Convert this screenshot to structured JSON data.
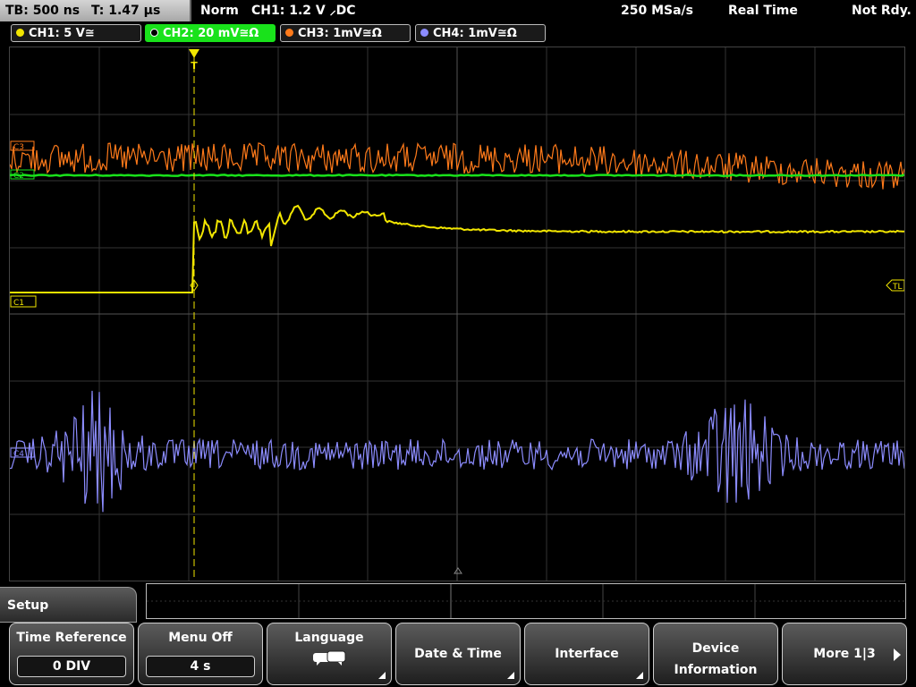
{
  "topbar": {
    "timebase": "TB: 500 ns",
    "trigger_time": "T: 1.47 µs",
    "mode": "Norm",
    "trigger_info": "CH1: 1.2 V ⸝DC",
    "sample_rate": "250 MSa/s",
    "acq_mode": "Real Time",
    "status": "Not Rdy."
  },
  "channels": [
    {
      "label": "CH1: 5 V≅",
      "color": "#f2e600",
      "active": false
    },
    {
      "label": "CH2: 20 mV≅Ω",
      "color": "#19e21b",
      "active": true
    },
    {
      "label": "CH3: 1mV≅Ω",
      "color": "#ff7a1a",
      "active": false
    },
    {
      "label": "CH4: 1mV≅Ω",
      "color": "#8c8cff",
      "active": false
    }
  ],
  "markers": {
    "c1": "C1",
    "c2": "C2",
    "c3": "C3",
    "c4": "C4",
    "trigger_level": "TL",
    "trigger_pos": "T"
  },
  "menu": {
    "title": "Setup",
    "softkeys": [
      {
        "label": "Time Reference",
        "value": "0 DIV"
      },
      {
        "label": "Menu Off",
        "value": "4 s"
      },
      {
        "label": "Language"
      },
      {
        "label": "Date & Time"
      },
      {
        "label": "Interface"
      },
      {
        "label": "Device",
        "label2": "Information"
      },
      {
        "label": "More 1|3"
      }
    ]
  }
}
